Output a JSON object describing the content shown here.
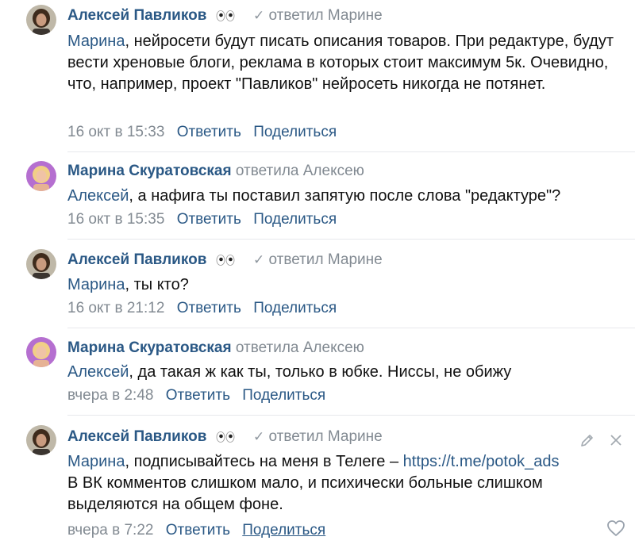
{
  "colors": {
    "link": "#2a5885",
    "muted": "#828a92",
    "divider": "#e7e8ec"
  },
  "comments": [
    {
      "author": "Алексей Павликов",
      "emoji": "eyes",
      "reply_to": "ответил Марине",
      "mention": "Марина",
      "text": ", нейросети будут писать описания товаров. При редактуре, будут вести хреновые блоги, реклама в которых стоит максимум 5к. Очевидно, что, например, проект \"Павликов\" нейросеть никогда не потянет.",
      "date": "16 окт в 15:33",
      "reply_label": "Ответить",
      "share_label": "Поделиться"
    },
    {
      "author": "Марина Скуратовская",
      "reply_to": "ответила Алексею",
      "mention": "Алексей",
      "text": ", а нафига ты поставил запятую после слова \"редактуре\"?",
      "date": "16 окт в 15:35",
      "reply_label": "Ответить",
      "share_label": "Поделиться"
    },
    {
      "author": "Алексей Павликов",
      "emoji": "eyes",
      "reply_to": "ответил Марине",
      "mention": "Марина",
      "text": ", ты кто?",
      "date": "16 окт в 21:12",
      "reply_label": "Ответить",
      "share_label": "Поделиться"
    },
    {
      "author": "Марина Скуратовская",
      "reply_to": "ответила Алексею",
      "mention": "Алексей",
      "text": ", да такая ж как ты, только в юбке. Ниссы, не обижу",
      "date": "вчера в 2:48",
      "reply_label": "Ответить",
      "share_label": "Поделиться"
    },
    {
      "author": "Алексей Павликов",
      "emoji": "eyes",
      "reply_to": "ответил Марине",
      "mention": "Марина",
      "text_before_link": ", подписывайтесь на меня в Телеге – ",
      "link": "https://t.me/potok_ads",
      "text_after_link": "В ВК комментов слишком мало, и психически больные слишком выделяются на общем фоне.",
      "date": "вчера в 7:22",
      "reply_label": "Ответить",
      "share_label": "Поделиться"
    }
  ]
}
